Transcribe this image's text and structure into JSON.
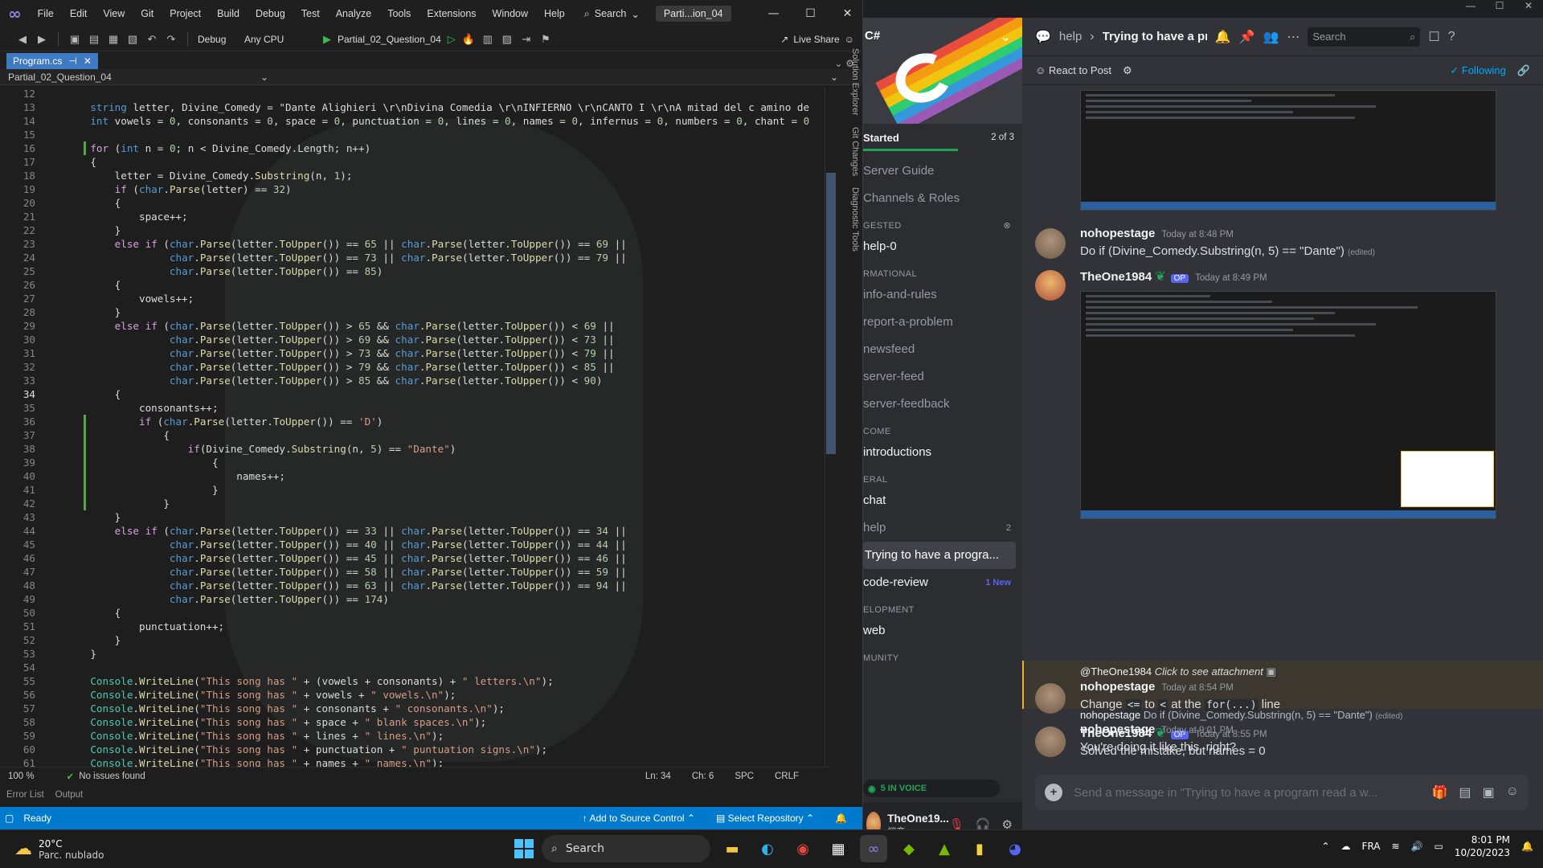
{
  "vs": {
    "menus": [
      "File",
      "Edit",
      "View",
      "Git",
      "Project",
      "Build",
      "Debug",
      "Test",
      "Analyze",
      "Tools",
      "Extensions",
      "Window",
      "Help"
    ],
    "search_label": "Search",
    "title": "Parti...ion_04",
    "toolbar": {
      "config": "Debug",
      "platform": "Any CPU",
      "run_target": "Partial_02_Question_04",
      "live_share": "Live Share"
    },
    "tab": {
      "name": "Program.cs",
      "pin": "⇲"
    },
    "nav_project": "Partial_02_Question_04",
    "side_tabs": [
      "Solution Explorer",
      "Git Changes",
      "Diagnostic Tools"
    ],
    "code_lines": [
      {
        "n": "12",
        "c": ""
      },
      {
        "n": "13",
        "c": "    string letter, Divine_Comedy = \"Dante Alighieri \\r\\nDivina Comedia \\r\\nINFIERNO \\r\\nCANTO I \\r\\nA mitad del c amino de"
      },
      {
        "n": "14",
        "c": "    int vowels = 0, consonants = 0, space = 0, punctuation = 0, lines = 0, names = 0, infernus = 0, numbers = 0, chant = 0"
      },
      {
        "n": "15",
        "c": ""
      },
      {
        "n": "16",
        "c": "    for (int n = 0; n < Divine_Comedy.Length; n++)"
      },
      {
        "n": "17",
        "c": "    {"
      },
      {
        "n": "18",
        "c": "        letter = Divine_Comedy.Substring(n, 1);"
      },
      {
        "n": "19",
        "c": "        if (char.Parse(letter) == 32)"
      },
      {
        "n": "20",
        "c": "        {"
      },
      {
        "n": "21",
        "c": "            space++;"
      },
      {
        "n": "22",
        "c": "        }"
      },
      {
        "n": "23",
        "c": "        else if (char.Parse(letter.ToUpper()) == 65 || char.Parse(letter.ToUpper()) == 69 ||"
      },
      {
        "n": "24",
        "c": "                 char.Parse(letter.ToUpper()) == 73 || char.Parse(letter.ToUpper()) == 79 ||"
      },
      {
        "n": "25",
        "c": "                 char.Parse(letter.ToUpper()) == 85)"
      },
      {
        "n": "26",
        "c": "        {"
      },
      {
        "n": "27",
        "c": "            vowels++;"
      },
      {
        "n": "28",
        "c": "        }"
      },
      {
        "n": "29",
        "c": "        else if (char.Parse(letter.ToUpper()) > 65 && char.Parse(letter.ToUpper()) < 69 ||"
      },
      {
        "n": "30",
        "c": "                 char.Parse(letter.ToUpper()) > 69 && char.Parse(letter.ToUpper()) < 73 ||"
      },
      {
        "n": "31",
        "c": "                 char.Parse(letter.ToUpper()) > 73 && char.Parse(letter.ToUpper()) < 79 ||"
      },
      {
        "n": "32",
        "c": "                 char.Parse(letter.ToUpper()) > 79 && char.Parse(letter.ToUpper()) < 85 ||"
      },
      {
        "n": "33",
        "c": "                 char.Parse(letter.ToUpper()) > 85 && char.Parse(letter.ToUpper()) < 90)"
      },
      {
        "n": "34",
        "c": "        {"
      },
      {
        "n": "35",
        "c": "            consonants++;"
      },
      {
        "n": "36",
        "c": "            if (char.Parse(letter.ToUpper()) == 'D')"
      },
      {
        "n": "37",
        "c": "                {"
      },
      {
        "n": "38",
        "c": "                    if(Divine_Comedy.Substring(n, 5) == \"Dante\")"
      },
      {
        "n": "39",
        "c": "                        {"
      },
      {
        "n": "40",
        "c": "                            names++;"
      },
      {
        "n": "41",
        "c": "                        }"
      },
      {
        "n": "42",
        "c": "                }"
      },
      {
        "n": "43",
        "c": "        }"
      },
      {
        "n": "44",
        "c": "        else if (char.Parse(letter.ToUpper()) == 33 || char.Parse(letter.ToUpper()) == 34 ||"
      },
      {
        "n": "45",
        "c": "                 char.Parse(letter.ToUpper()) == 40 || char.Parse(letter.ToUpper()) == 44 ||"
      },
      {
        "n": "46",
        "c": "                 char.Parse(letter.ToUpper()) == 45 || char.Parse(letter.ToUpper()) == 46 ||"
      },
      {
        "n": "47",
        "c": "                 char.Parse(letter.ToUpper()) == 58 || char.Parse(letter.ToUpper()) == 59 ||"
      },
      {
        "n": "48",
        "c": "                 char.Parse(letter.ToUpper()) == 63 || char.Parse(letter.ToUpper()) == 94 ||"
      },
      {
        "n": "49",
        "c": "                 char.Parse(letter.ToUpper()) == 174)"
      },
      {
        "n": "50",
        "c": "        {"
      },
      {
        "n": "51",
        "c": "            punctuation++;"
      },
      {
        "n": "52",
        "c": "        }"
      },
      {
        "n": "53",
        "c": "    }"
      },
      {
        "n": "54",
        "c": ""
      },
      {
        "n": "55",
        "c": "    Console.WriteLine(\"This song has \" + (vowels + consonants) + \" letters.\\n\");"
      },
      {
        "n": "56",
        "c": "    Console.WriteLine(\"This song has \" + vowels + \" vowels.\\n\");"
      },
      {
        "n": "57",
        "c": "    Console.WriteLine(\"This song has \" + consonants + \" consonants.\\n\");"
      },
      {
        "n": "58",
        "c": "    Console.WriteLine(\"This song has \" + space + \" blank spaces.\\n\");"
      },
      {
        "n": "59",
        "c": "    Console.WriteLine(\"This song has \" + lines + \" lines.\\n\");"
      },
      {
        "n": "60",
        "c": "    Console.WriteLine(\"This song has \" + punctuation + \" puntuation signs.\\n\");"
      },
      {
        "n": "61",
        "c": "    Console.WriteLine(\"This song has \" + names + \" names.\\n\");"
      }
    ],
    "current_line": "34",
    "editor_status": {
      "zoom": "100 %",
      "issues": "No issues found",
      "ln": "Ln: 34",
      "ch": "Ch: 6",
      "spc": "SPC",
      "crlf": "CRLF"
    },
    "tool_tabs": [
      "Error List",
      "Output"
    ],
    "status": {
      "ready": "Ready",
      "source_control": "Add to Source Control",
      "repo": "Select Repository"
    }
  },
  "discord": {
    "server": "C#",
    "started": {
      "label": "Started",
      "count": "2 of 3"
    },
    "sidebar": [
      {
        "type": "ch",
        "label": "Server Guide",
        "style": "dim"
      },
      {
        "type": "ch",
        "label": "Channels & Roles",
        "style": "dim"
      },
      {
        "type": "cat",
        "label": "GESTED"
      },
      {
        "type": "ch",
        "label": "help-0",
        "style": "bright"
      },
      {
        "type": "cat",
        "label": "RMATIONAL"
      },
      {
        "type": "ch",
        "label": "info-and-rules",
        "style": "dim"
      },
      {
        "type": "ch",
        "label": "report-a-problem",
        "style": "dim"
      },
      {
        "type": "ch",
        "label": "newsfeed",
        "style": "dim"
      },
      {
        "type": "ch",
        "label": "server-feed",
        "style": "dim"
      },
      {
        "type": "ch",
        "label": "server-feedback",
        "style": "dim"
      },
      {
        "type": "cat",
        "label": "COME"
      },
      {
        "type": "ch",
        "label": "introductions",
        "style": "bright"
      },
      {
        "type": "cat",
        "label": "ERAL"
      },
      {
        "type": "ch",
        "label": "chat",
        "style": "bright"
      },
      {
        "type": "ch",
        "label": "help",
        "style": "dim",
        "badge": "2"
      },
      {
        "type": "ch",
        "label": "Trying to have a progra...",
        "style": "active"
      },
      {
        "type": "ch",
        "label": "code-review",
        "style": "bright",
        "badge": "1 New"
      },
      {
        "type": "cat",
        "label": "ELOPMENT"
      },
      {
        "type": "ch",
        "label": "web",
        "style": "bright"
      },
      {
        "type": "cat",
        "label": "MUNITY"
      }
    ],
    "voice": "5 IN VOICE",
    "user": {
      "name": "TheOne19...",
      "sub": "初恋"
    },
    "header": {
      "channel": "help",
      "thread": "Trying to have a pr",
      "search": "Search"
    },
    "subheader": {
      "react": "React to Post",
      "following": "Following"
    },
    "messages": [
      {
        "user": "nohopestage",
        "time": "Today at 8:48 PM",
        "text": "Do if (Divine_Comedy.Substring(n, 5) == \"Dante\")",
        "edited": "(edited)"
      },
      {
        "user": "TheOne1984",
        "op": "OP",
        "time": "Today at 8:49 PM"
      },
      {
        "reply": "@TheOne1984",
        "reply_text": "Click to see attachment",
        "user": "nohopestage",
        "time": "Today at 8:54 PM",
        "t1": "Change",
        "c1": "<=",
        "t2": "to",
        "c2": "<",
        "t3": "at the",
        "c3": "for(...)",
        "t4": "line"
      },
      {
        "user": "TheOne1984",
        "op": "OP",
        "time": "Today at 8:55 PM",
        "text": "Solved the mistake, but names = 0"
      },
      {
        "reply": "nohopestage",
        "reply_text": "Do if (Divine_Comedy.Substring(n, 5) == \"Dante\")",
        "reply_edited": "(edited)",
        "user": "nohopestage",
        "time": "Today at 9:01 PM",
        "text": "You're doing it like this, right?"
      }
    ],
    "composer": "Send a message in \"Trying to have a program read a w..."
  },
  "taskbar": {
    "temp": "20°C",
    "weather": "Parc. nublado",
    "search": "Search",
    "lang": "FRA",
    "time": "8:01 PM",
    "date": "10/20/2023"
  }
}
